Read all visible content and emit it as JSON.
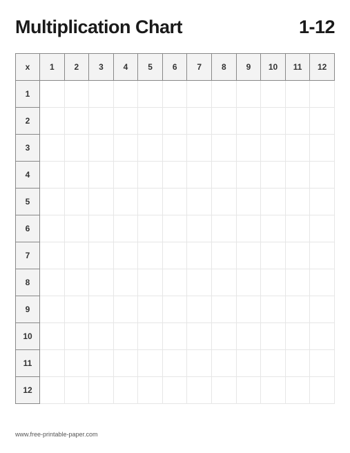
{
  "header": {
    "title": "Multiplication Chart",
    "range": "1-12"
  },
  "grid": {
    "corner": "x",
    "columns": [
      "1",
      "2",
      "3",
      "4",
      "5",
      "6",
      "7",
      "8",
      "9",
      "10",
      "11",
      "12"
    ],
    "rows": [
      "1",
      "2",
      "3",
      "4",
      "5",
      "6",
      "7",
      "8",
      "9",
      "10",
      "11",
      "12"
    ]
  },
  "footer": {
    "text": "www.free-printable-paper.com"
  }
}
